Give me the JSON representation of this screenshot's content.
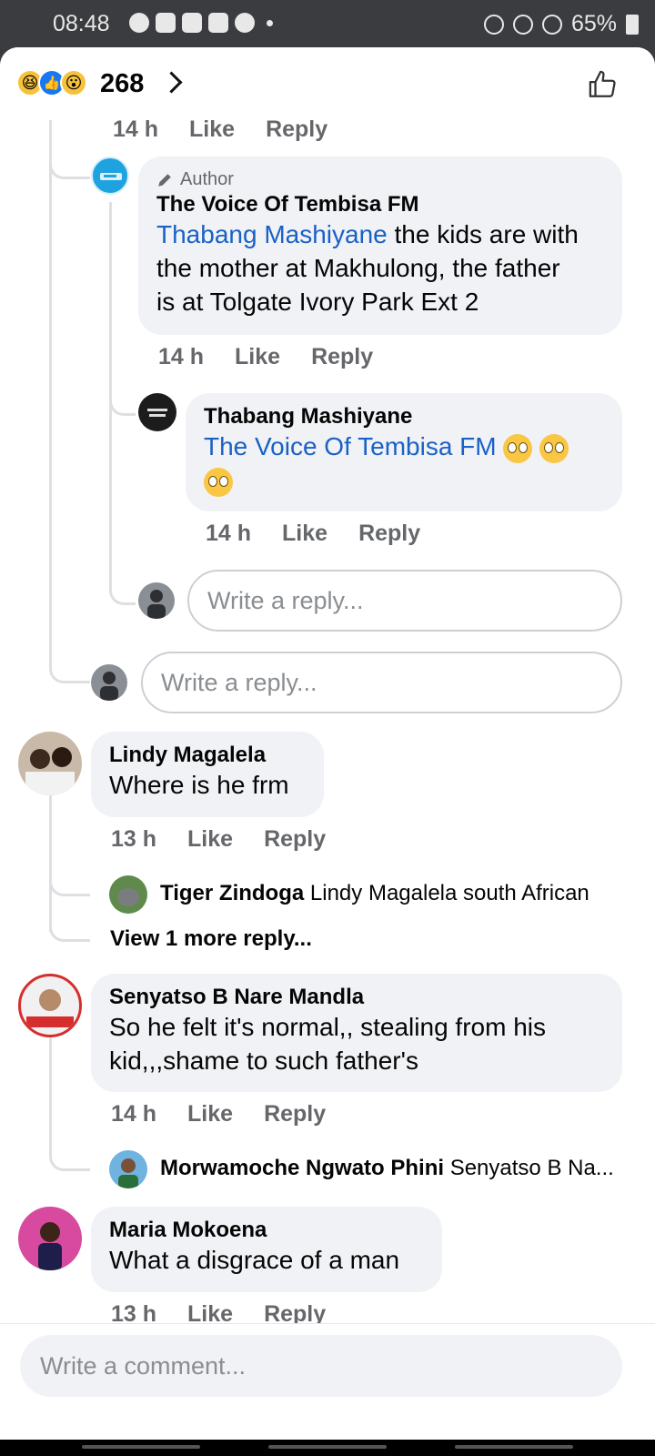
{
  "status_bar": {
    "time": "08:48",
    "battery": "65%"
  },
  "header": {
    "reaction_count": "268",
    "reactions": [
      "haha",
      "like",
      "wow"
    ]
  },
  "cut_top_meta": {
    "time": "14 h",
    "like": "Like",
    "reply": "Reply"
  },
  "comments": [
    {
      "author_badge": "Author",
      "name": "The Voice Of Tembisa FM",
      "mention": "Thabang Mashiyane",
      "text_line1": "the kids are with",
      "text_line2": "the mother at Makhulong, the father",
      "text_line3": "is at Tolgate Ivory Park Ext 2",
      "time": "14 h",
      "like": "Like",
      "reply": "Reply"
    },
    {
      "name": "Thabang Mashiyane",
      "mention": "The Voice Of Tembisa FM",
      "emoji": "face-with-rolling-eyes x3",
      "time": "14 h",
      "like": "Like",
      "reply": "Reply"
    },
    {
      "name": "Lindy Magalela",
      "text": "Where is he frm",
      "time": "13 h",
      "like": "Like",
      "reply": "Reply",
      "nested_reply": {
        "name": "Tiger Zindoga",
        "text": "Lindy Magalela south African"
      },
      "view_more": "View 1 more reply..."
    },
    {
      "name": "Senyatso B Nare Mandla",
      "text_line1": "So he felt it's normal,, stealing from his",
      "text_line2": "kid,,,shame to such father's",
      "time": "14 h",
      "like": "Like",
      "reply": "Reply",
      "nested_reply": {
        "name": "Morwamoche Ngwato Phini",
        "text": "Senyatso B Na..."
      }
    },
    {
      "name": "Maria Mokoena",
      "text": "What a disgrace of a man",
      "time": "13 h",
      "like": "Like",
      "reply": "Reply"
    }
  ],
  "reply_boxes": {
    "placeholder": "Write a reply..."
  },
  "composer": {
    "placeholder": "Write a comment..."
  }
}
